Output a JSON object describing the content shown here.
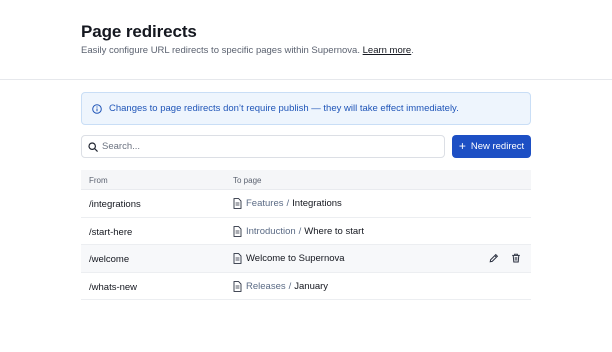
{
  "header": {
    "title": "Page redirects",
    "subtitle": "Easily configure URL redirects to specific pages within Supernova.",
    "learn_more": "Learn more",
    "subtitle_end": "."
  },
  "banner": {
    "icon": "info-icon",
    "text": "Changes to page redirects don’t require publish — they will take effect immediately."
  },
  "search": {
    "icon": "search-icon",
    "placeholder": "Search...",
    "value": ""
  },
  "toolbar": {
    "new_redirect_label": "New redirect"
  },
  "table": {
    "columns": [
      "From",
      "To page"
    ],
    "rows": [
      {
        "from": "/integrations",
        "to_section": "Features",
        "to_page": "Integrations"
      },
      {
        "from": "/start-here",
        "to_section": "Introduction",
        "to_page": "Where to start"
      },
      {
        "from": "/welcome",
        "to_section": "",
        "to_page": "Welcome to Supernova",
        "hovered": true,
        "actions": [
          "edit-icon",
          "trash-icon"
        ]
      },
      {
        "from": "/whats-new",
        "to_section": "Releases",
        "to_page": "January"
      }
    ]
  },
  "colors": {
    "accent": "#1d4fc4",
    "banner_bg": "#eef5fd",
    "banner_text": "#1f55b8",
    "breadcrumb": "#5b6b85"
  }
}
